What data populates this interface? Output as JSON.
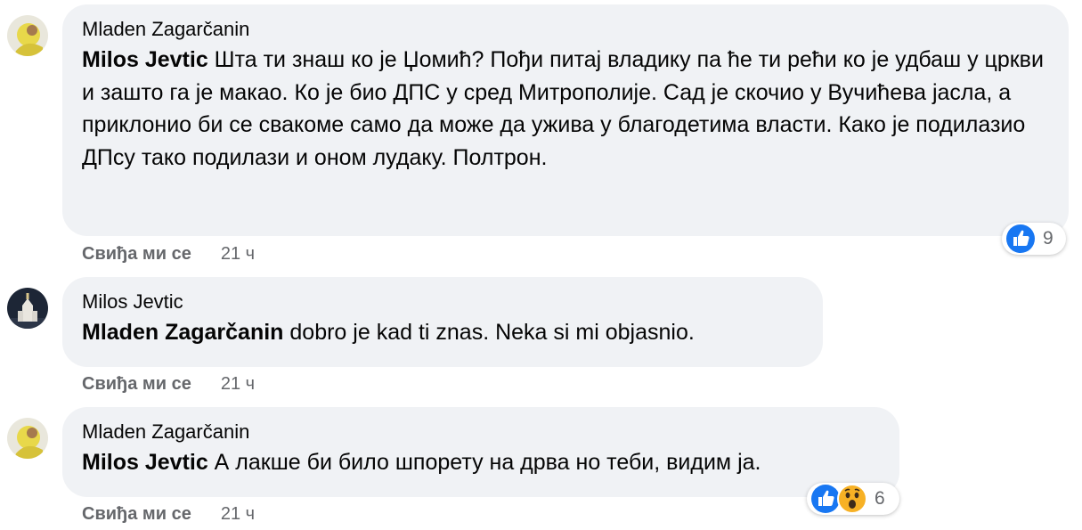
{
  "comments": [
    {
      "author": "Mladen Zagarčanin",
      "mention": "Milos Jevtic",
      "text": " Шта ти знаш ко је Џомић? Пођи питај владику па ће ти рећи ко је удбаш у цркви и зашто га је макао. Ко је био ДПС у сред Митрополије. Сад је скочио у Вучићева јасла, а приклонио би се свакоме само да може да ужива у благодетима власти. Како је подилазио ДПсу тако подилази и оном лудаку. Полтрон.",
      "like_label": "Свиђа ми се",
      "time": "21 ч",
      "reactions": [
        "like-icon"
      ],
      "reaction_count": "9"
    },
    {
      "author": "Milos Jevtic",
      "mention": "Mladen Zagarčanin",
      "text": " dobro je kad ti znas. Neka si mi objasnio.",
      "like_label": "Свиђа ми се",
      "time": "21 ч",
      "reactions": [],
      "reaction_count": ""
    },
    {
      "author": "Mladen Zagarčanin",
      "mention": "Milos Jevtic",
      "text": " А лакше би било шпорету на дрва но теби, видим ја.",
      "like_label": "Свиђа ми се",
      "time": "21 ч",
      "reactions": [
        "like-icon",
        "wow-icon"
      ],
      "reaction_count": "6"
    }
  ],
  "colors": {
    "bubble": "#f0f2f5",
    "meta_text": "#65676b",
    "like_blue": "#1877f2",
    "wow_yellow": "#f7b125"
  }
}
